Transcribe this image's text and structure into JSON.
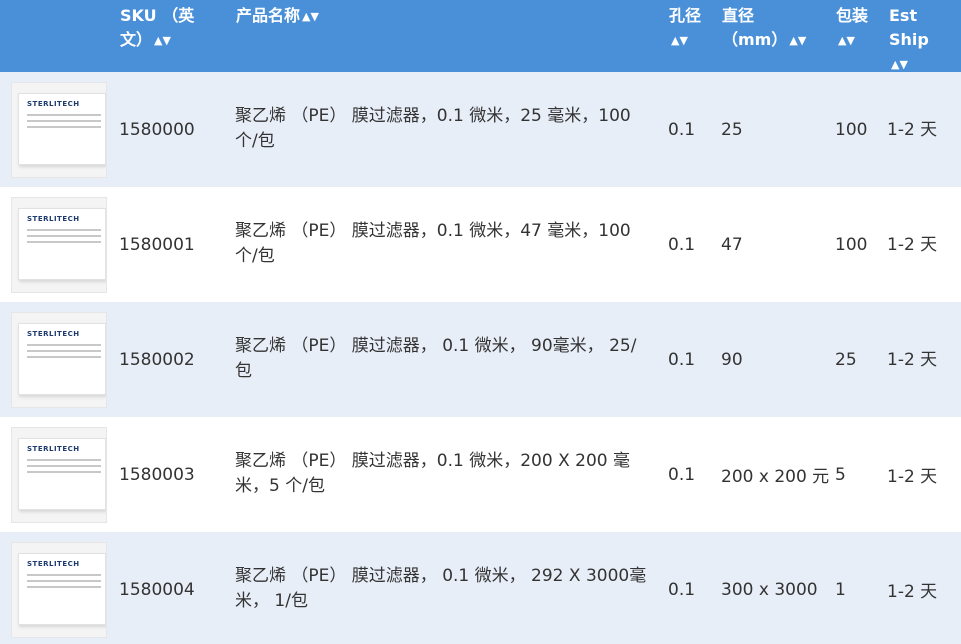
{
  "header": {
    "sku": "SKU （英文）",
    "name": "产品名称",
    "pore": "孔径",
    "diameter": "直径 （mm）",
    "pack": "包装",
    "ship": "Est Ship"
  },
  "icons": {
    "sort": "sort-arrows-icon"
  },
  "rows": [
    {
      "brand": "STERLITECH",
      "sku": "1580000",
      "name": "聚乙烯 （PE） 膜过滤器，0.1 微米，25 毫米，100 个/包",
      "pore": "0.1",
      "diameter": "25",
      "pack": "100",
      "ship": "1-2 天"
    },
    {
      "brand": "STERLITECH",
      "sku": "1580001",
      "name": "聚乙烯 （PE） 膜过滤器，0.1 微米，47 毫米，100 个/包",
      "pore": "0.1",
      "diameter": "47",
      "pack": "100",
      "ship": "1-2 天"
    },
    {
      "brand": "STERLITECH",
      "sku": "1580002",
      "name": "聚乙烯 （PE） 膜过滤器， 0.1 微米， 90毫米， 25/包",
      "pore": "0.1",
      "diameter": "90",
      "pack": "25",
      "ship": "1-2 天"
    },
    {
      "brand": "STERLITECH",
      "sku": "1580003",
      "name": "聚乙烯 （PE） 膜过滤器，0.1 微米，200 X 200 毫米，5 个/包",
      "pore": "0.1",
      "diameter": "200 x 200 元",
      "pack": "5",
      "ship": "1-2 天"
    },
    {
      "brand": "STERLITECH",
      "sku": "1580004",
      "name": "聚乙烯 （PE） 膜过滤器， 0.1 微米， 292 X 3000毫米， 1/包",
      "pore": "0.1",
      "diameter": "300 x 3000",
      "pack": "1",
      "ship": "1-2 天"
    }
  ]
}
